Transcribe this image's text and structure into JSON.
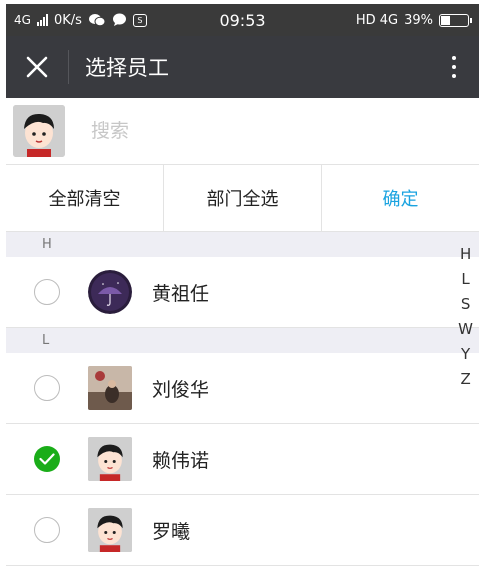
{
  "status_bar": {
    "network": "4G",
    "speed": "0K/s",
    "time": "09:53",
    "network_right": "HD 4G",
    "battery": "39%",
    "battery_level": 0.39
  },
  "title_bar": {
    "title": "选择员工"
  },
  "search": {
    "placeholder": "搜索"
  },
  "actions": {
    "clear_all": "全部清空",
    "select_department": "部门全选",
    "confirm": "确定"
  },
  "sections": [
    {
      "letter": "H",
      "items": [
        {
          "name": "黄祖任",
          "checked": false
        }
      ]
    },
    {
      "letter": "L",
      "items": [
        {
          "name": "刘俊华",
          "checked": false
        },
        {
          "name": "赖伟诺",
          "checked": true
        },
        {
          "name": "罗曦",
          "checked": false
        }
      ]
    }
  ],
  "index_letters": [
    "H",
    "L",
    "S",
    "W",
    "Y",
    "Z"
  ],
  "colors": {
    "title_bar": "#393a3f",
    "status_bar": "#3a3a3a",
    "accent": "#1aa3e0",
    "checked": "#1aad19",
    "section_bg": "#eeeef4"
  }
}
